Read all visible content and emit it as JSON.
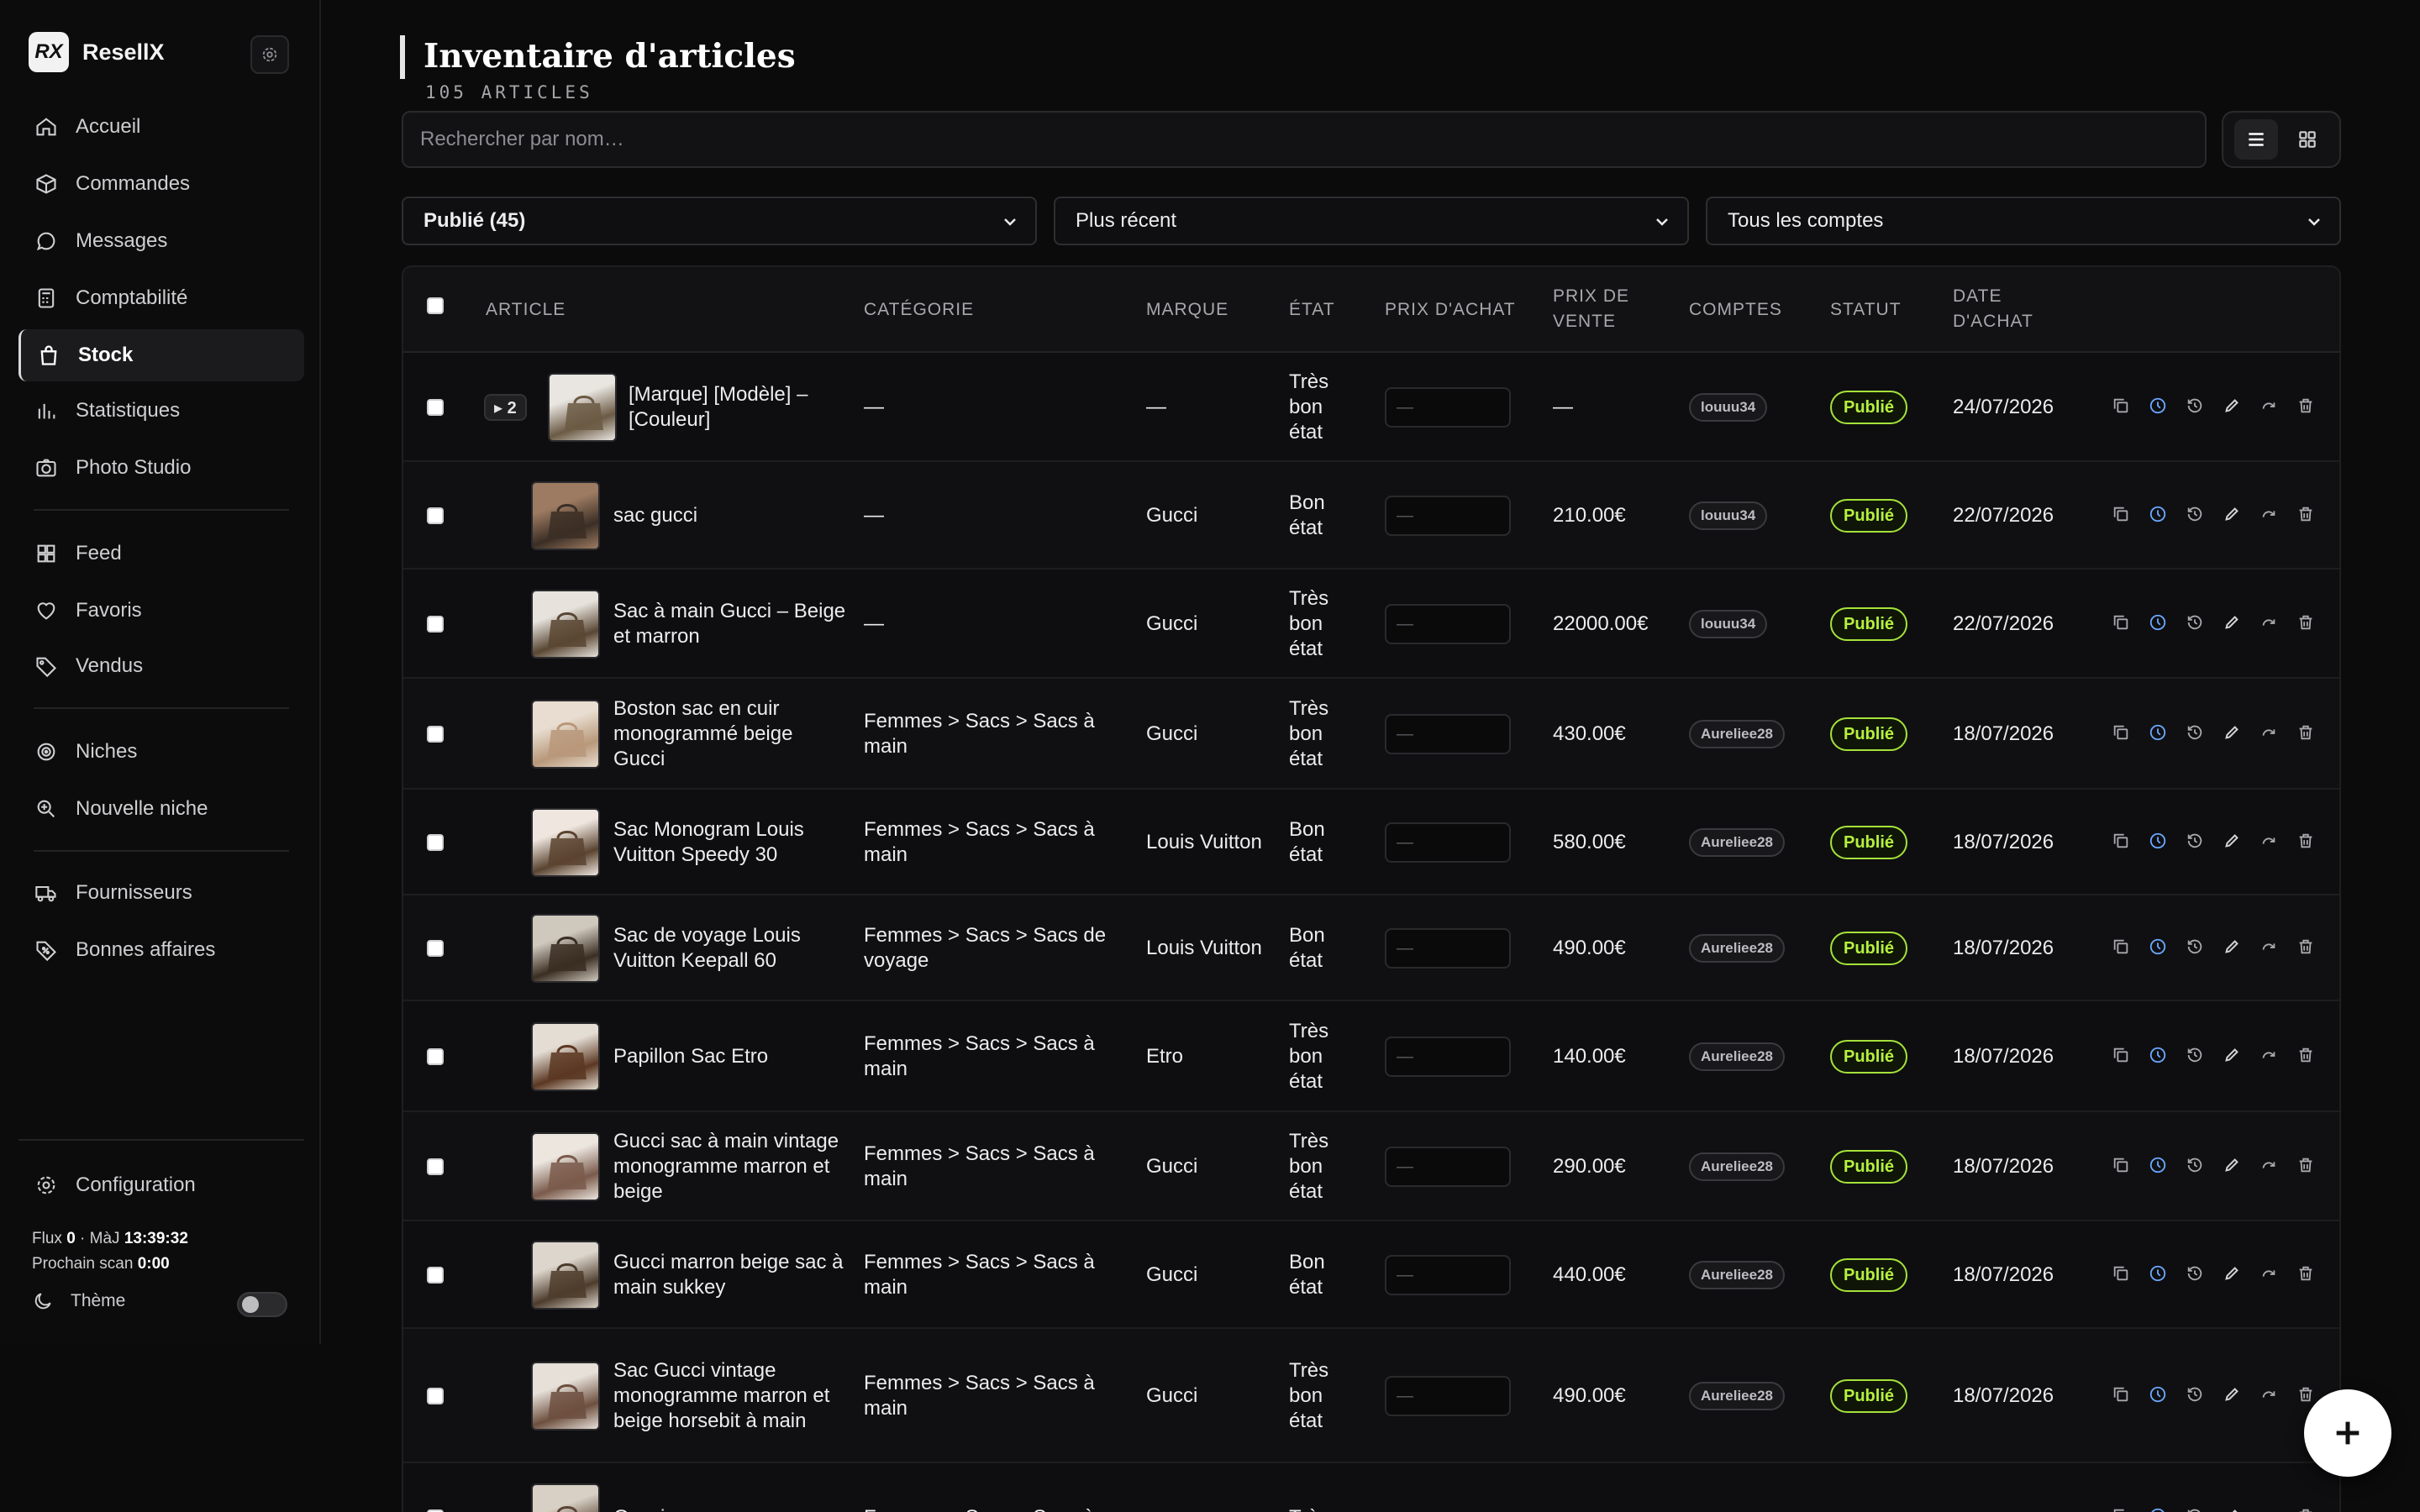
{
  "brand": {
    "logo": "RX",
    "name": "ResellX"
  },
  "nav": [
    {
      "label": "Accueil",
      "icon": "home-icon"
    },
    {
      "label": "Commandes",
      "icon": "box-icon"
    },
    {
      "label": "Messages",
      "icon": "message-icon"
    },
    {
      "label": "Comptabilité",
      "icon": "calculator-icon"
    },
    {
      "label": "Stock",
      "icon": "bag-icon",
      "active": true
    },
    {
      "label": "Statistiques",
      "icon": "bar-chart-icon"
    },
    {
      "label": "Photo Studio",
      "icon": "camera-icon"
    },
    {
      "label": "Feed",
      "icon": "grid-icon"
    },
    {
      "label": "Favoris",
      "icon": "heart-icon"
    },
    {
      "label": "Vendus",
      "icon": "tag-icon"
    },
    {
      "label": "Niches",
      "icon": "target-icon"
    },
    {
      "label": "Nouvelle niche",
      "icon": "search-plus-icon"
    },
    {
      "label": "Fournisseurs",
      "icon": "truck-icon"
    },
    {
      "label": "Bonnes affaires",
      "icon": "percent-tag-icon"
    }
  ],
  "footer": {
    "config_label": "Configuration",
    "flux_label": "Flux",
    "flux_value": "0",
    "maj_label": "· MàJ",
    "maj_value": "13:39:32",
    "scan_label": "Prochain scan",
    "scan_value": "0:00",
    "theme_label": "Thème"
  },
  "page": {
    "title": "Inventaire d'articles",
    "subtitle": "105 ARTICLES",
    "search_placeholder": "Rechercher par nom…"
  },
  "filters": [
    "Publié (45)",
    "Plus récent",
    "Tous les comptes"
  ],
  "table": {
    "headers": [
      "ARTICLE",
      "CATÉGORIE",
      "MARQUE",
      "ÉTAT",
      "PRIX D'ACHAT",
      "PRIX DE VENTE",
      "COMPTES",
      "STATUT",
      "DATE D'ACHAT"
    ],
    "price_placeholder": "—",
    "rows": [
      {
        "group": "▸ 2",
        "title": "[Marque] [Modèle] – [Couleur]",
        "category": "—",
        "brand": "—",
        "state": "Très bon état",
        "sale": "—",
        "account": "louuu34",
        "status": "Publié",
        "date": "24/07/2026"
      },
      {
        "title": "sac gucci",
        "category": "—",
        "brand": "Gucci",
        "state": "Bon état",
        "sale": "210.00€",
        "account": "louuu34",
        "status": "Publié",
        "date": "22/07/2026"
      },
      {
        "title": "Sac à main Gucci – Beige et marron",
        "category": "—",
        "brand": "Gucci",
        "state": "Très bon état",
        "sale": "22000.00€",
        "account": "louuu34",
        "status": "Publié",
        "date": "22/07/2026"
      },
      {
        "title": "Boston sac en cuir monogrammé beige Gucci",
        "category": "Femmes > Sacs > Sacs à main",
        "brand": "Gucci",
        "state": "Très bon état",
        "sale": "430.00€",
        "account": "Aureliee28",
        "status": "Publié",
        "date": "18/07/2026"
      },
      {
        "title": "Sac Monogram Louis Vuitton Speedy 30",
        "category": "Femmes > Sacs > Sacs à main",
        "brand": "Louis Vuitton",
        "state": "Bon état",
        "sale": "580.00€",
        "account": "Aureliee28",
        "status": "Publié",
        "date": "18/07/2026"
      },
      {
        "title": "Sac de voyage Louis Vuitton Keepall 60",
        "category": "Femmes > Sacs > Sacs de voyage",
        "brand": "Louis Vuitton",
        "state": "Bon état",
        "sale": "490.00€",
        "account": "Aureliee28",
        "status": "Publié",
        "date": "18/07/2026"
      },
      {
        "title": "Papillon Sac Etro",
        "category": "Femmes > Sacs > Sacs à main",
        "brand": "Etro",
        "state": "Très bon état",
        "sale": "140.00€",
        "account": "Aureliee28",
        "status": "Publié",
        "date": "18/07/2026"
      },
      {
        "title": "Gucci sac à main vintage monogramme marron et beige",
        "category": "Femmes > Sacs > Sacs à main",
        "brand": "Gucci",
        "state": "Très bon état",
        "sale": "290.00€",
        "account": "Aureliee28",
        "status": "Publié",
        "date": "18/07/2026"
      },
      {
        "title": "Gucci marron beige sac à main sukkey",
        "category": "Femmes > Sacs > Sacs à main",
        "brand": "Gucci",
        "state": "Bon état",
        "sale": "440.00€",
        "account": "Aureliee28",
        "status": "Publié",
        "date": "18/07/2026"
      },
      {
        "title": "Sac Gucci vintage monogramme marron et beige horsebit à main",
        "category": "Femmes > Sacs > Sacs à main",
        "brand": "Gucci",
        "state": "Très bon état",
        "sale": "490.00€",
        "account": "Aureliee28",
        "status": "Publié",
        "date": "18/07/2026"
      },
      {
        "title": "Gucci monogramme",
        "category": "Femmes > Sacs > Sacs à",
        "brand": "",
        "state": "Très",
        "sale": "",
        "account": "",
        "status": "",
        "date": ""
      }
    ]
  },
  "colors": {
    "accent_status": "#b6f03f",
    "action_clock": "#6aa7ff",
    "background": "#0b0b0c"
  }
}
